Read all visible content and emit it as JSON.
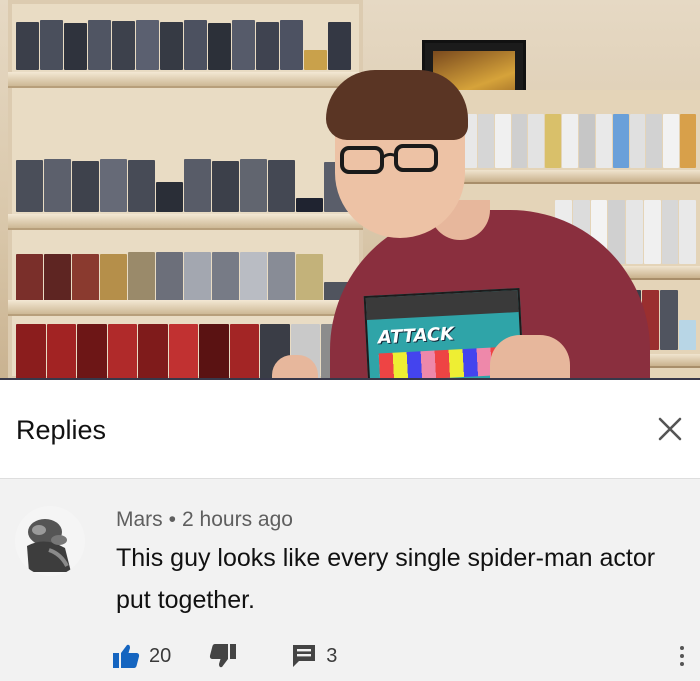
{
  "panel": {
    "title": "Replies",
    "close_icon": "close-icon"
  },
  "comment": {
    "author": "Mars",
    "separator": "•",
    "time": "2 hours ago",
    "text": "This guy looks like every single spider-man actor put together.",
    "likes": "20",
    "replies": "3",
    "icons": {
      "like": "thumbs-up-icon",
      "dislike": "thumbs-down-icon",
      "reply": "comment-icon",
      "more": "more-vertical-icon"
    },
    "colors": {
      "like_active": "#1565c0",
      "text": "#111111",
      "meta": "#5f5f5f",
      "background": "#f2f2f2"
    }
  },
  "game_box_title": "ATTACK"
}
